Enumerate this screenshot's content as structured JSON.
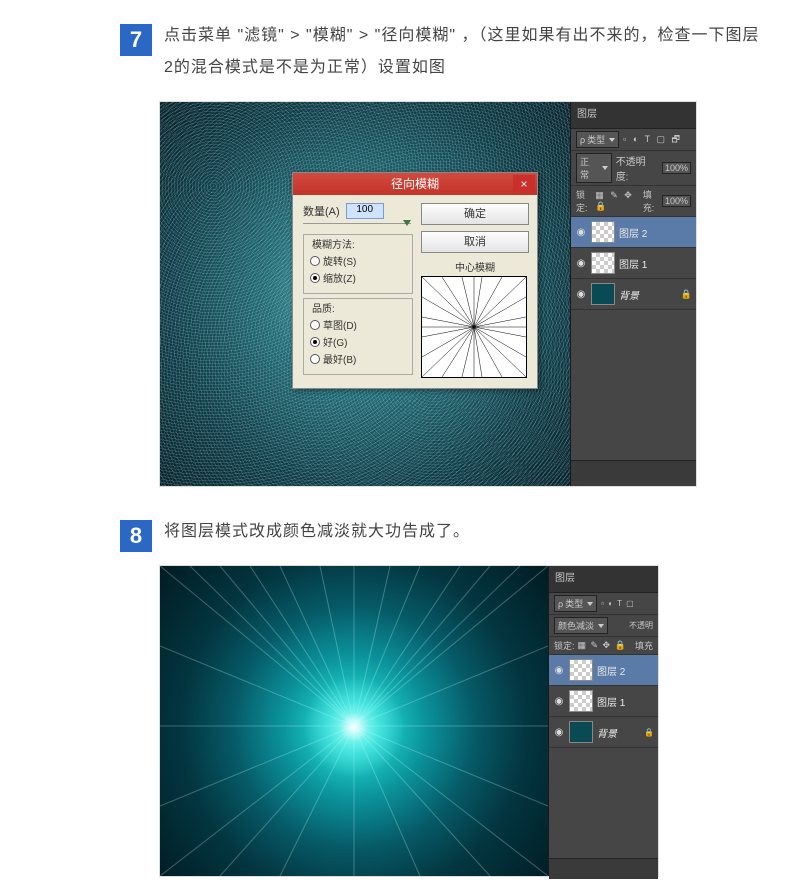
{
  "steps": {
    "s7": {
      "num": "7",
      "text": "点击菜单 \"滤镜\" > \"模糊\" > \"径向模糊\" ，（这里如果有出不来的，检查一下图层2的混合模式是不是为正常）设置如图"
    },
    "s8": {
      "num": "8",
      "text": "将图层模式改成颜色减淡就大功告成了。"
    }
  },
  "dialog": {
    "title": "径向模糊",
    "close": "×",
    "amount_label": "数量(A)",
    "amount_value": "100",
    "ok": "确定",
    "cancel": "取消",
    "method_title": "模糊方法:",
    "method_spin": "旋转(S)",
    "method_zoom": "缩放(Z)",
    "quality_title": "品质:",
    "quality_draft": "草图(D)",
    "quality_good": "好(G)",
    "quality_best": "最好(B)",
    "preview_label": "中心模糊"
  },
  "panel7": {
    "tab": "图层",
    "kind": "类型",
    "blend": "正常",
    "opacity_label": "不透明度:",
    "opacity_value": "100%",
    "lock_label": "锁定:",
    "fill_label": "填充:",
    "fill_value": "100%",
    "layers": [
      {
        "name": "图层 2",
        "sel": true,
        "thumb": "checker"
      },
      {
        "name": "图层 1",
        "sel": false,
        "thumb": "checker"
      },
      {
        "name": "背景",
        "sel": false,
        "thumb": "teal",
        "italic": true
      }
    ]
  },
  "panel8": {
    "tab": "图层",
    "kind": "类型",
    "blend": "颜色减淡",
    "opacity_label": "不透明",
    "lock_label": "锁定:",
    "fill_label": "填充",
    "layers": [
      {
        "name": "图层 2",
        "sel": true,
        "thumb": "checker"
      },
      {
        "name": "图层 1",
        "sel": false,
        "thumb": "checker"
      },
      {
        "name": "背景",
        "sel": false,
        "thumb": "teal",
        "italic": true
      }
    ]
  }
}
